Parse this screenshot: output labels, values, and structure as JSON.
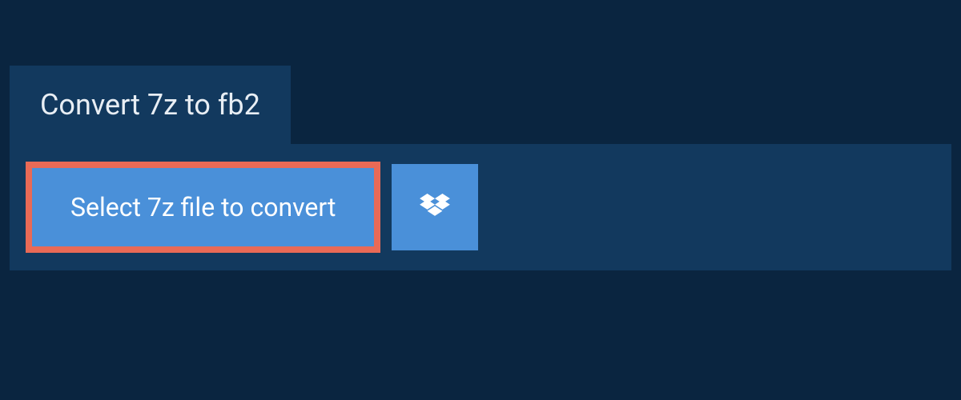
{
  "header": {
    "title": "Convert 7z to fb2"
  },
  "actions": {
    "select_file_label": "Select 7z file to convert",
    "dropbox_icon_name": "dropbox-icon"
  },
  "colors": {
    "background": "#0a2540",
    "panel": "#12395e",
    "button": "#4a90d9",
    "highlight_border": "#e96a56",
    "text_light": "#e8eef4",
    "text_white": "#ffffff"
  }
}
